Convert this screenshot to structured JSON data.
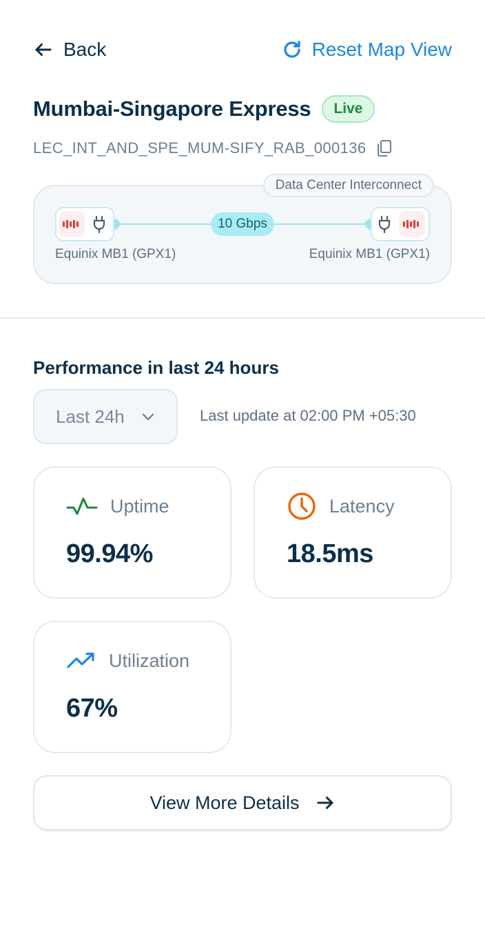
{
  "header": {
    "back_label": "Back",
    "reset_label": "Reset Map View"
  },
  "circuit": {
    "name": "Mumbai-Singapore Express",
    "status": "Live",
    "id": "LEC_INT_AND_SPE_MUM-SIFY_RAB_000136",
    "type": "Data Center Interconnect",
    "bandwidth": "10 Gbps",
    "endpoint_a": "Equinix MB1 (GPX1)",
    "endpoint_b": "Equinix MB1 (GPX1)"
  },
  "performance": {
    "title": "Performance in last 24 hours",
    "range": "Last 24h",
    "last_update": "Last update at 02:00 PM +05:30",
    "metrics": [
      {
        "label": "Uptime",
        "value": "99.94%",
        "icon": "pulse-icon",
        "color": "#1f8a3f"
      },
      {
        "label": "Latency",
        "value": "18.5ms",
        "icon": "clock-icon",
        "color": "#f0640a"
      },
      {
        "label": "Utilization",
        "value": "67%",
        "icon": "trending-up-icon",
        "color": "#1b87e6"
      }
    ]
  },
  "footer": {
    "more_label": "View More Details"
  },
  "colors": {
    "brand_blue": "#1b87e6",
    "live_green": "#1f8a3f",
    "equinix_red": "#e5383b",
    "link_cyan": "#9fe3ee"
  }
}
